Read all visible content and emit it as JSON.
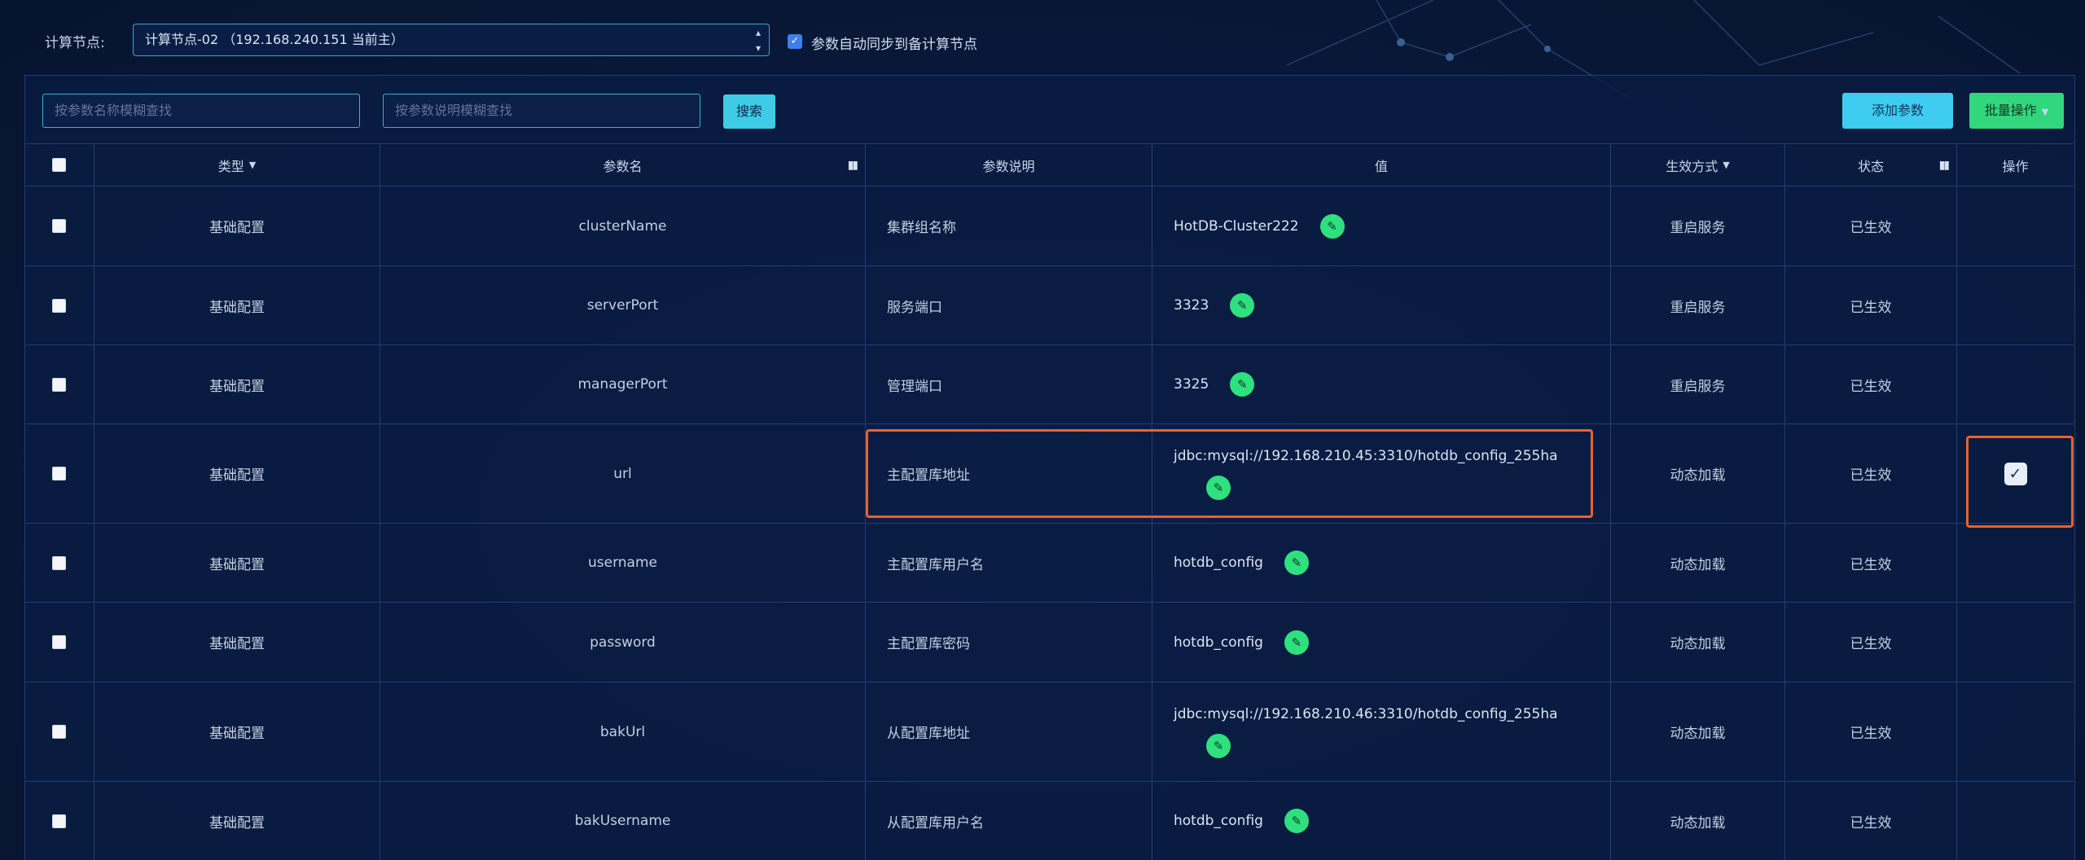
{
  "toolbar": {
    "node_label": "计算节点:",
    "node_selected": "计算节点-02 （192.168.240.151 当前主）",
    "sync_checked": true,
    "sync_label": "参数自动同步到备计算节点",
    "search_name_placeholder": "按参数名称模糊查找",
    "search_desc_placeholder": "按参数说明模糊查找",
    "search_button": "搜索",
    "add_button": "添加参数",
    "batch_button": "批量操作"
  },
  "table": {
    "headers": {
      "type": "类型",
      "name": "参数名",
      "desc": "参数说明",
      "value": "值",
      "mode": "生效方式",
      "status": "状态",
      "op": "操作"
    },
    "rows": [
      {
        "type": "基础配置",
        "name": "clusterName",
        "desc": "集群组名称",
        "value": "HotDB-Cluster222",
        "mode": "重启服务",
        "status": "已生效"
      },
      {
        "type": "基础配置",
        "name": "serverPort",
        "desc": "服务端口",
        "value": "3323",
        "mode": "重启服务",
        "status": "已生效"
      },
      {
        "type": "基础配置",
        "name": "managerPort",
        "desc": "管理端口",
        "value": "3325",
        "mode": "重启服务",
        "status": "已生效"
      },
      {
        "type": "基础配置",
        "name": "url",
        "desc": "主配置库地址",
        "value": "jdbc:mysql://192.168.210.45:3310/hotdb_config_255ha",
        "mode": "动态加载",
        "status": "已生效"
      },
      {
        "type": "基础配置",
        "name": "username",
        "desc": "主配置库用户名",
        "value": "hotdb_config",
        "mode": "动态加载",
        "status": "已生效"
      },
      {
        "type": "基础配置",
        "name": "password",
        "desc": "主配置库密码",
        "value": "hotdb_config",
        "mode": "动态加载",
        "status": "已生效"
      },
      {
        "type": "基础配置",
        "name": "bakUrl",
        "desc": "从配置库地址",
        "value": "jdbc:mysql://192.168.210.46:3310/hotdb_config_255ha",
        "mode": "动态加载",
        "status": "已生效"
      },
      {
        "type": "基础配置",
        "name": "bakUsername",
        "desc": "从配置库用户名",
        "value": "hotdb_config",
        "mode": "动态加载",
        "status": "已生效"
      }
    ]
  },
  "icons": {
    "edit": "pencil-icon",
    "confirm": "check-icon",
    "filter": "filter-icon",
    "sort": "caret-down-icon"
  },
  "colors": {
    "accent_cyan": "#3ecdf0",
    "accent_green": "#32d67c",
    "highlight": "#e9612e",
    "background": "#0a1a3c"
  }
}
